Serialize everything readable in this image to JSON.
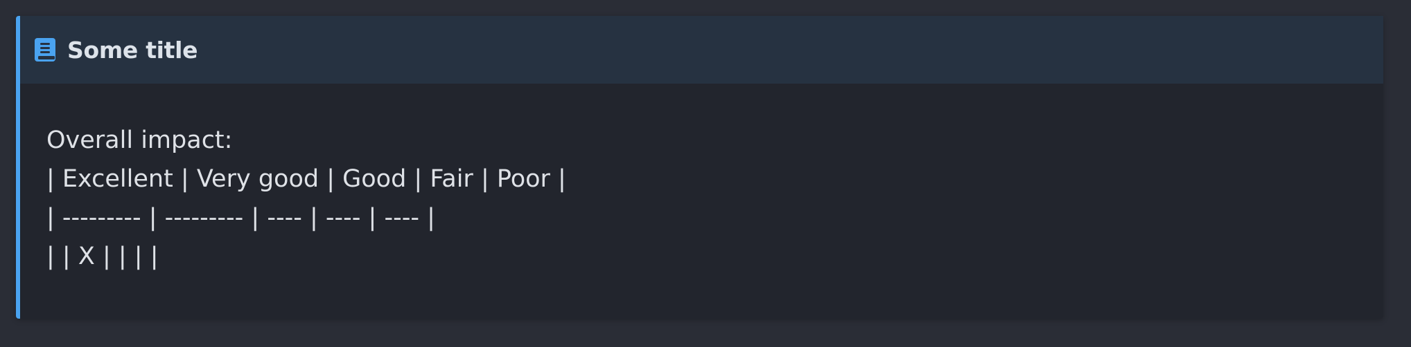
{
  "callout": {
    "title": "Some title",
    "icon": "book-icon",
    "accent_color": "#4aa3f0",
    "lines": [
      "Overall impact:",
      "| Excellent | Very good | Good | Fair | Poor |",
      "| --------- | --------- | ---- | ---- | ---- |",
      "| | X | | | |"
    ]
  }
}
